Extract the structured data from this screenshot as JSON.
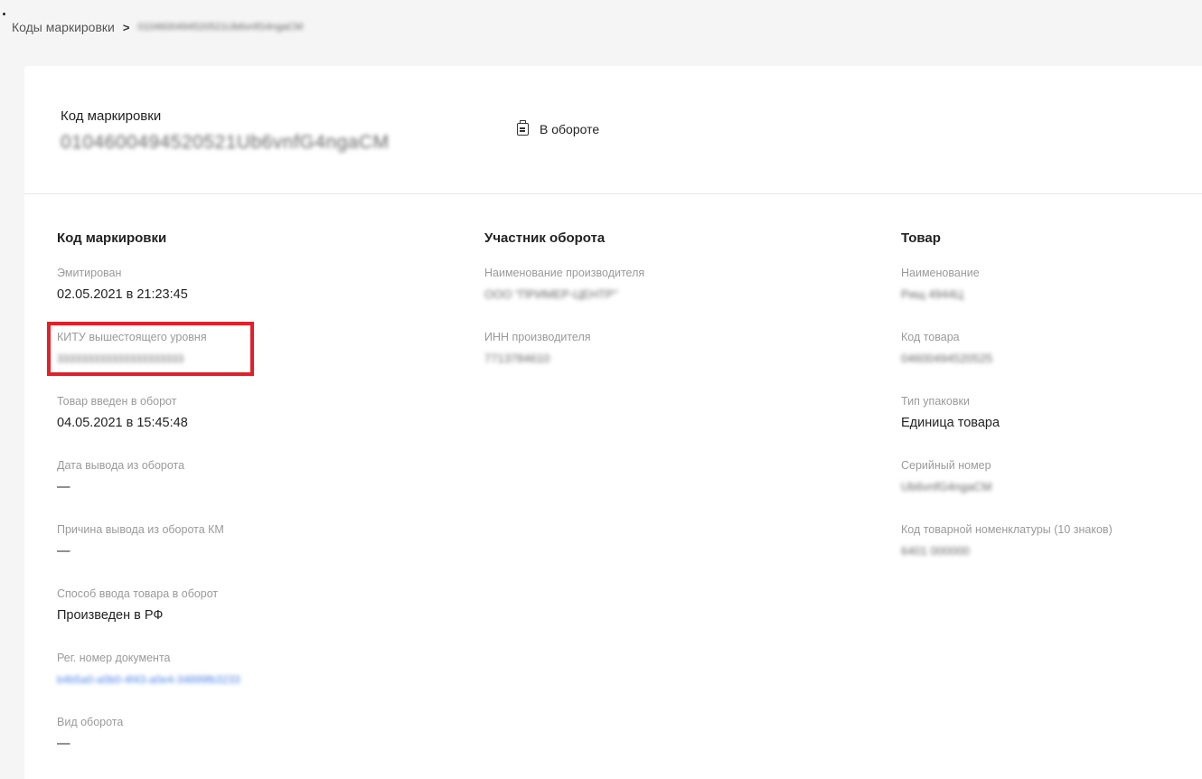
{
  "breadcrumb": {
    "root": "Коды маркировки",
    "separator": ">",
    "current_code": "0104600494520521Ub6vnfG4ngaCM"
  },
  "header": {
    "title": "Код маркировки",
    "code": "0104600494520521Ub6vnfG4ngaCM",
    "status_icon": "status-clipboard-icon",
    "status": "В обороте"
  },
  "columns": {
    "marking": {
      "title": "Код маркировки",
      "fields": [
        {
          "label": "Эмитирован",
          "value": "02.05.2021 в 21:23:45"
        },
        {
          "label": "КИТУ вышестоящего уровня",
          "value": "333333333333333333333"
        },
        {
          "label": "Товар введен в оборот",
          "value": "04.05.2021 в 15:45:48"
        },
        {
          "label": "Дата вывода из оборота",
          "value": "—"
        },
        {
          "label": "Причина вывода из оборота КМ",
          "value": "—"
        },
        {
          "label": "Способ ввода товара в оборот",
          "value": "Произведен в РФ"
        },
        {
          "label": "Рег. номер документа",
          "value": "b4b5a0-a0b0-4f43-a0e4-34899fb3233"
        },
        {
          "label": "Вид оборота",
          "value": "—"
        }
      ]
    },
    "participant": {
      "title": "Участник оборота",
      "fields": [
        {
          "label": "Наименование производителя",
          "value": "ООО \"ПРИМЕР-ЦЕНТР\""
        },
        {
          "label": "ИНН производителя",
          "value": "7713784610"
        }
      ]
    },
    "product": {
      "title": "Товар",
      "fields": [
        {
          "label": "Наименование",
          "value": "Рищ 4944Ц"
        },
        {
          "label": "Код товара",
          "value": "04600494520525"
        },
        {
          "label": "Тип упаковки",
          "value": "Единица товара"
        },
        {
          "label": "Серийный номер",
          "value": "Ub6vnfG4ngaCM"
        },
        {
          "label": "Код товарной номенклатуры (10 знаков)",
          "value": "6401 000000"
        }
      ]
    }
  },
  "colors": {
    "highlight_border": "#e32028",
    "link": "#4a7fe6",
    "label": "#9a9a9a"
  }
}
